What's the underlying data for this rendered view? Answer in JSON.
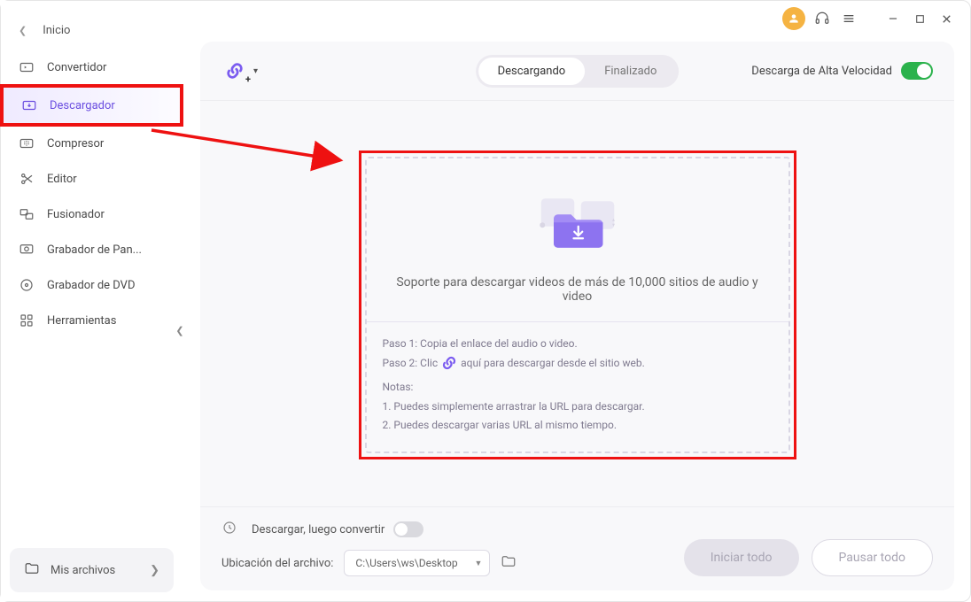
{
  "home_label": "Inicio",
  "sidebar_items": [
    {
      "label": "Convertidor",
      "icon": "convert"
    },
    {
      "label": "Descargador",
      "icon": "download",
      "active": true
    },
    {
      "label": "Compresor",
      "icon": "compress"
    },
    {
      "label": "Editor",
      "icon": "editor"
    },
    {
      "label": "Fusionador",
      "icon": "merge"
    },
    {
      "label": "Grabador de Pan...",
      "icon": "screenrec"
    },
    {
      "label": "Grabador de DVD",
      "icon": "dvd"
    },
    {
      "label": "Herramientas",
      "icon": "tools"
    }
  ],
  "my_files_label": "Mis archivos",
  "tabs": {
    "downloading": "Descargando",
    "finished": "Finalizado"
  },
  "high_speed_label": "Descarga de Alta Velocidad",
  "drop": {
    "headline": "Soporte para descargar videos de más de 10,000 sitios de audio y video",
    "step1": "Paso 1: Copia el enlace del audio o video.",
    "step2_a": "Paso 2: Clic",
    "step2_b": "aquí para descargar desde el sitio web.",
    "notes_label": "Notas:",
    "note1": "1. Puedes simplemente arrastrar la URL para descargar.",
    "note2": "2. Puedes descargar varias URL al mismo tiempo."
  },
  "bottom": {
    "convert_after_label": "Descargar, luego convertir",
    "location_label": "Ubicación del archivo:",
    "path_value": "C:\\Users\\ws\\Desktop",
    "start_all": "Iniciar todo",
    "pause_all": "Pausar todo"
  }
}
